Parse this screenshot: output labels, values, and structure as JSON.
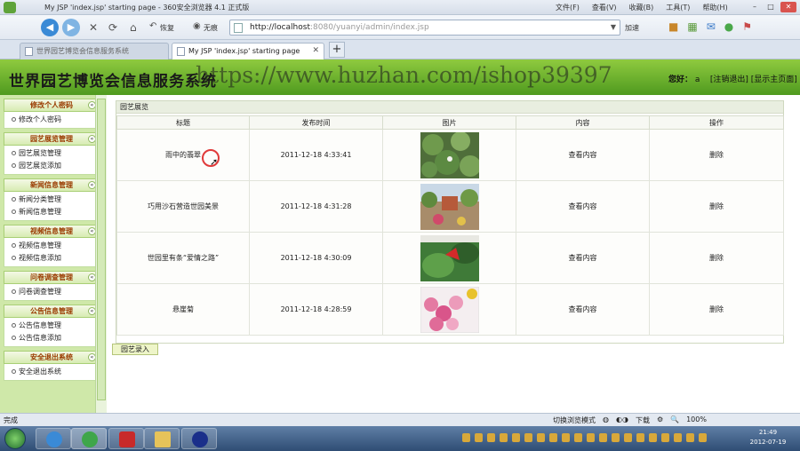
{
  "browser": {
    "window_title": "My JSP 'index.jsp' starting page - 360安全浏览器 4.1 正式版",
    "menu": [
      "文件(F)",
      "查看(V)",
      "收藏(B)",
      "工具(T)",
      "帮助(H)"
    ],
    "toolbar": {
      "restore_label": "恢复",
      "no_trace_label": "无痕",
      "speedup_label": "加速"
    },
    "address": {
      "host": "http://localhost",
      "rest": ":8080/yuanyi/admin/index.jsp"
    },
    "tabs": [
      {
        "label": "世界园艺博览会信息服务系统",
        "active": false
      },
      {
        "label": "My JSP 'index.jsp' starting page",
        "active": true
      }
    ],
    "statusbar": {
      "status": "完成",
      "switch_mode": "切换浏览模式",
      "download": "下载",
      "zoom": "100%"
    }
  },
  "header": {
    "site_title": "世界园艺博览会信息服务系统",
    "watermark": "https://www.huzhan.com/ishop39397",
    "greeting": "您好：",
    "username": "a",
    "logout": "[注销退出]",
    "home": "[显示主页面]"
  },
  "sidebar": {
    "sections": [
      {
        "title": "修改个人密码",
        "items": [
          "修改个人密码"
        ]
      },
      {
        "title": "园艺展览管理",
        "items": [
          "园艺展览管理",
          "园艺展览添加"
        ]
      },
      {
        "title": "新闻信息管理",
        "items": [
          "新闻分类管理",
          "新闻信息管理"
        ]
      },
      {
        "title": "视频信息管理",
        "items": [
          "视频信息管理",
          "视频信息添加"
        ]
      },
      {
        "title": "问卷调查管理",
        "items": [
          "问卷调查管理"
        ]
      },
      {
        "title": "公告信息管理",
        "items": [
          "公告信息管理",
          "公告信息添加"
        ]
      },
      {
        "title": "安全退出系统",
        "items": [
          "安全退出系统"
        ]
      }
    ]
  },
  "main": {
    "panel_title": "园艺展览",
    "columns": [
      "标题",
      "发布时间",
      "图片",
      "内容",
      "操作"
    ],
    "rows": [
      {
        "title": "雨中的翡翠",
        "time": "2011-12-18 4:33:41",
        "content": "查看内容",
        "action": "删除"
      },
      {
        "title": "巧用沙石营造世园美景",
        "time": "2011-12-18 4:31:28",
        "content": "查看内容",
        "action": "删除"
      },
      {
        "title": "世园里有条“爱情之路”",
        "time": "2011-12-18 4:30:09",
        "content": "查看内容",
        "action": "删除"
      },
      {
        "title": "悬崖菊",
        "time": "2011-12-18 4:28:59",
        "content": "查看内容",
        "action": "删除"
      }
    ],
    "add_button": "园艺录入"
  },
  "taskbar": {
    "time": "21:49",
    "date": "2012-07-19"
  }
}
